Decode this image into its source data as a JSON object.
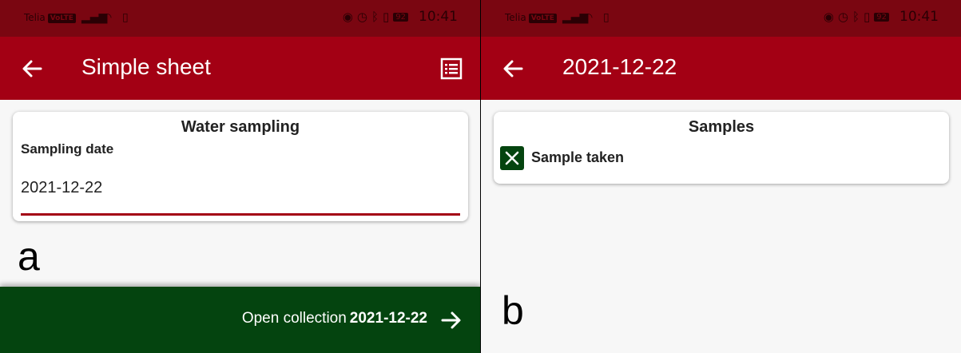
{
  "colors": {
    "status_bar": "#7a0611",
    "app_bar": "#a30014",
    "accent": "#a30014",
    "action_bar": "#04440f",
    "background": "#f7f7f7"
  },
  "panel_a": {
    "letter": "a",
    "status_bar": {
      "carrier": "Telia",
      "network_badge": "VoLTE",
      "battery": "92",
      "time": "10:41"
    },
    "app_bar": {
      "title": "Simple sheet",
      "back_icon": "arrow-left-icon",
      "action_icon": "list-icon"
    },
    "card": {
      "title": "Water sampling",
      "field_label": "Sampling date",
      "field_value": "2021-12-22"
    },
    "bottom_bar": {
      "label": "Open collection",
      "value": "2021-12-22",
      "icon": "arrow-right-icon"
    }
  },
  "panel_b": {
    "letter": "b",
    "status_bar": {
      "carrier": "Telia",
      "network_badge": "VoLTE",
      "battery": "92",
      "time": "10:41"
    },
    "app_bar": {
      "title": "2021-12-22",
      "back_icon": "arrow-left-icon"
    },
    "card": {
      "title": "Samples",
      "checkbox_label": "Sample taken",
      "checkbox_checked": true
    }
  }
}
